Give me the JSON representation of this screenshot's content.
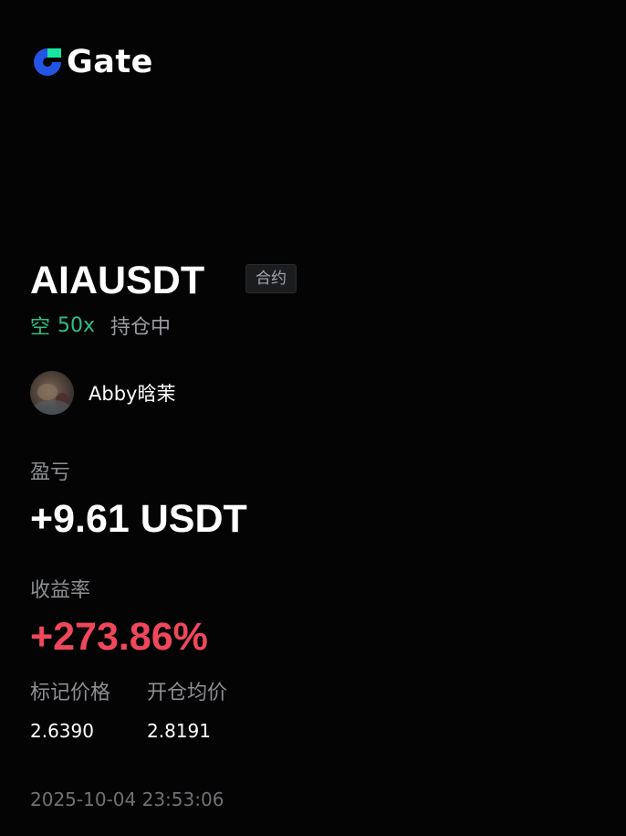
{
  "brand": {
    "name": "Gate",
    "icon": "gate-logo-icon",
    "colors": {
      "blue": "#2354e6",
      "green": "#17e6a1"
    }
  },
  "position": {
    "pair": "AIAUSDT",
    "type_tag": "合约",
    "side": "空",
    "leverage": "50x",
    "status": "持仓中",
    "side_color": "#2fbd85"
  },
  "user": {
    "name": "Abby晗茉",
    "avatar": "avatar-image"
  },
  "pnl": {
    "label": "盈亏",
    "value": "+9.61 USDT"
  },
  "roi": {
    "label": "收益率",
    "value": "+273.86%",
    "color": "#f0475b"
  },
  "prices": {
    "mark_label": "标记价格",
    "mark_value": "2.6390",
    "entry_label": "开仓均价",
    "entry_value": "2.8191"
  },
  "timestamp": "2025-10-04 23:53:06"
}
